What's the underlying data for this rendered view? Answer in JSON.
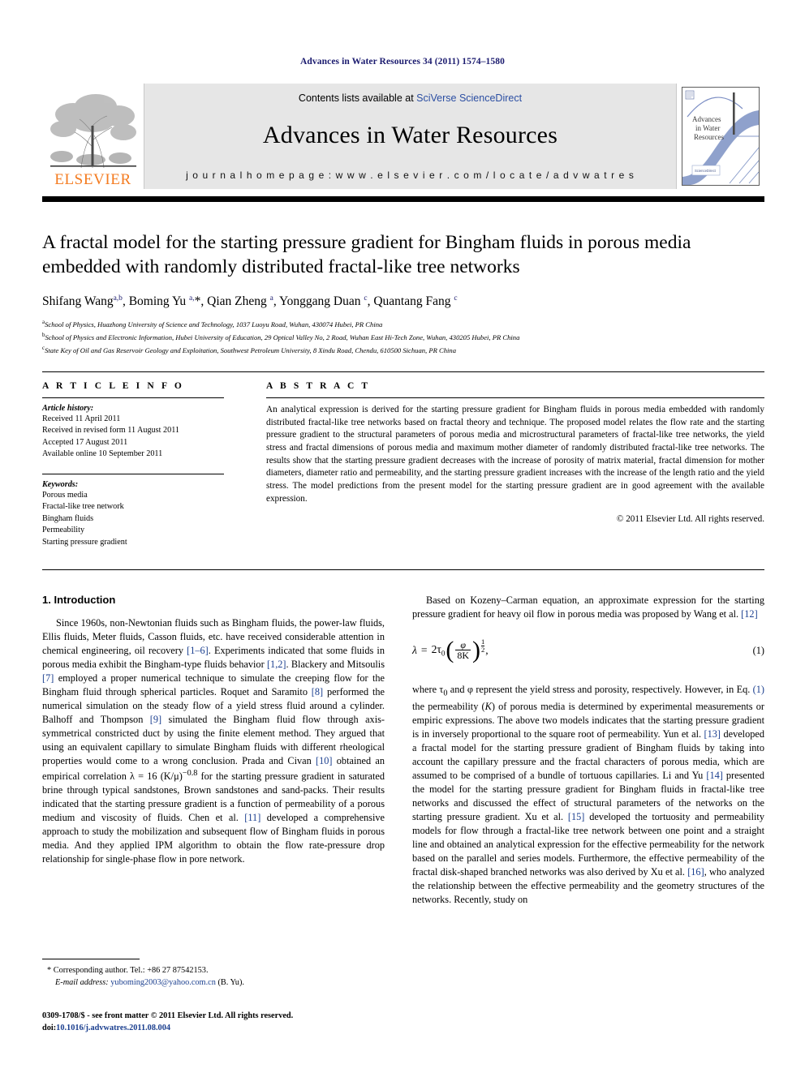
{
  "running_head": "Advances in Water Resources 34 (2011) 1574–1580",
  "masthead": {
    "publisher_name": "ELSEVIER",
    "contents_prefix": "Contents lists available at ",
    "contents_link": "SciVerse ScienceDirect",
    "journal_name": "Advances in Water Resources",
    "homepage_line": "j o u r n a l   h o m e p a g e :   w w w . e l s e v i e r . c o m / l o c a t e / a d v w a t r e s",
    "cover_title_line1": "Advances",
    "cover_title_line2": "in Water",
    "cover_title_line3": "Resources",
    "cover_footer": "ScienceDirect",
    "band_color": "#e6e6e6",
    "elsevier_orange": "#F47B20",
    "link_blue": "#2b4ea2"
  },
  "article": {
    "title": "A fractal model for the starting pressure gradient for Bingham fluids in porous media embedded with randomly distributed fractal-like tree networks",
    "authors_html": "Shifang Wang<sup>a,b</sup>, Boming Yu <sup>a,</sup>*, Qian Zheng <sup>a</sup>, Yonggang Duan <sup>c</sup>, Quantang Fang <sup>c</sup>",
    "affiliations": [
      "School of Physics, Huazhong University of Science and Technology, 1037 Luoyu Road, Wuhan, 430074 Hubei, PR China",
      "School of Physics and Electronic Information, Hubei University of Education, 29 Optical Valley No, 2 Road, Wuhan East Hi-Tech Zone, Wuhan, 430205 Hubei, PR China",
      "State Key of Oil and Gas Reservoir Geology and Exploitation, Southwest Petroleum University, 8 Xindu Road, Chendu, 610500 Sichuan, PR China"
    ],
    "affiliation_marks": [
      "a",
      "b",
      "c"
    ]
  },
  "article_info": {
    "heading": "A R T I C L E   I N F O",
    "history_label": "Article history:",
    "history": [
      "Received 11 April 2011",
      "Received in revised form 11 August 2011",
      "Accepted 17 August 2011",
      "Available online 10 September 2011"
    ],
    "keywords_label": "Keywords:",
    "keywords": [
      "Porous media",
      "Fractal-like tree network",
      "Bingham fluids",
      "Permeability",
      "Starting pressure gradient"
    ]
  },
  "abstract": {
    "heading": "A B S T R A C T",
    "text": "An analytical expression is derived for the starting pressure gradient for Bingham fluids in porous media embedded with randomly distributed fractal-like tree networks based on fractal theory and technique. The proposed model relates the flow rate and the starting pressure gradient to the structural parameters of porous media and microstructural parameters of fractal-like tree networks, the yield stress and fractal dimensions of porous media and maximum mother diameter of randomly distributed fractal-like tree networks. The results show that the starting pressure gradient decreases with the increase of porosity of matrix material, fractal dimension for mother diameters, diameter ratio and permeability, and the starting pressure gradient increases with the increase of the length ratio and the yield stress. The model predictions from the present model for the starting pressure gradient are in good agreement with the available expression.",
    "copyright": "© 2011 Elsevier Ltd. All rights reserved."
  },
  "body": {
    "section_number_title": "1. Introduction",
    "left_paragraph_1_parts": [
      "Since 1960s, non-Newtonian fluids such as Bingham fluids, the power-law fluids, Ellis fluids, Meter fluids, Casson fluids, etc. have received considerable attention in chemical engineering, oil recovery ",
      "[1–6]",
      ". Experiments indicated that some fluids in porous media exhibit the Bingham-type fluids behavior ",
      "[1,2]",
      ". Blackery and Mitsoulis ",
      "[7]",
      " employed a proper numerical technique to simulate the creeping flow for the Bingham fluid through spherical particles. Roquet and Saramito ",
      "[8]",
      " performed the numerical simulation on the steady flow of a yield stress fluid around a cylinder. Balhoff and Thompson ",
      "[9]",
      " simulated the Bingham fluid flow through axis-symmetrical constricted duct by using the finite element method. They argued that using an equivalent capillary to simulate Bingham fluids with different rheological properties would come to a wrong conclusion. Prada and Civan ",
      "[10]",
      " obtained an empirical correlation λ = 16 (K/μ)<sup>−0.8</sup> for the starting pressure gradient in saturated brine through typical sandstones, Brown sandstones and sand-packs. Their results indicated that the starting pressure gradient is a function of permeability of a porous medium and viscosity of fluids. Chen et al. ",
      "[11]",
      " developed a comprehensive approach to study the mobilization and subsequent flow of Bingham fluids in porous media. And they applied IPM algorithm to obtain the flow rate-pressure drop relationship for single-phase flow in pore network."
    ],
    "right_paragraph_1_parts": [
      "Based on Kozeny–Carman equation, an approximate expression for the starting pressure gradient for heavy oil flow in porous media was proposed by Wang et al. ",
      "[12]"
    ],
    "equation": {
      "lhs": "λ",
      "equals": "=",
      "coefficient": "2τ",
      "coefficient_sub": "0",
      "numerator": "φ",
      "denominator": "8K",
      "exponent_num": "1",
      "exponent_den": "2",
      "trailing": ",",
      "number": "(1)"
    },
    "right_paragraph_2_parts": [
      "where τ<sub>0</sub> and φ represent the yield stress and porosity, respectively. However, in Eq. ",
      "(1)",
      " the permeability (<i>K</i>) of porous media is determined by experimental measurements or empiric expressions. The above two models indicates that the starting pressure gradient is in inversely proportional to the square root of permeability. Yun et al. ",
      "[13]",
      " developed a fractal model for the starting pressure gradient of Bingham fluids by taking into account the capillary pressure and the fractal characters of porous media, which are assumed to be comprised of a bundle of tortuous capillaries. Li and Yu ",
      "[14]",
      " presented the model for the starting pressure gradient for Bingham fluids in fractal-like tree networks and discussed the effect of structural parameters of the networks on the starting pressure gradient. Xu et al. ",
      "[15]",
      " developed the tortuosity and permeability models for flow through a fractal-like tree network between one point and a straight line and obtained an analytical expression for the effective permeability for the network based on the parallel and series models. Furthermore, the effective permeability of the fractal disk-shaped branched networks was also derived by Xu et al. ",
      "[16]",
      ", who analyzed the relationship between the effective permeability and the geometry structures of the networks. Recently, study on"
    ]
  },
  "footnotes": {
    "corresponding": "* Corresponding author. Tel.: +86 27 87542153.",
    "email_label": "E-mail address:",
    "email": "yuboming2003@yahoo.com.cn",
    "email_suffix": "(B. Yu).",
    "frontmatter": "0309-1708/$ - see front matter © 2011 Elsevier Ltd. All rights reserved.",
    "doi_label": "doi:",
    "doi": "10.1016/j.advwatres.2011.08.004"
  }
}
